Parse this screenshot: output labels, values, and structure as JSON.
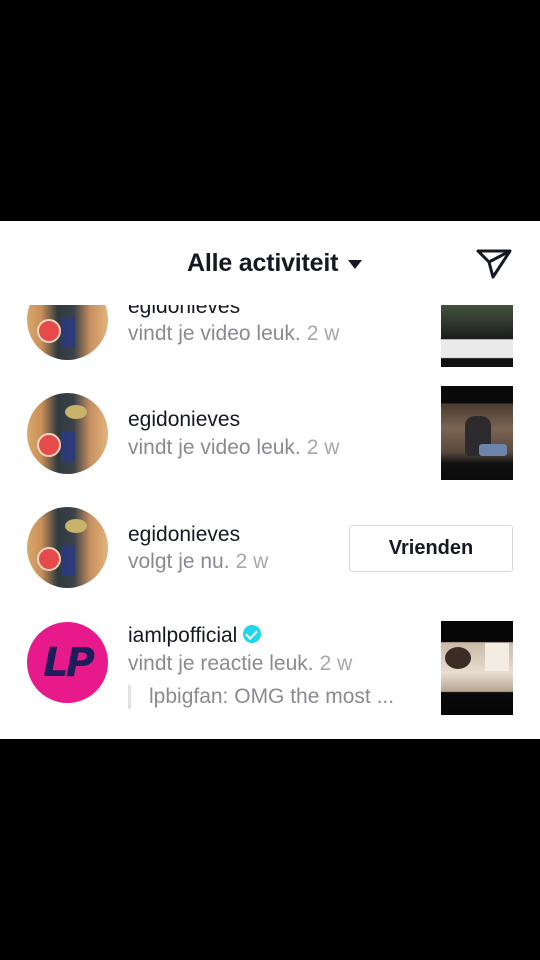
{
  "header": {
    "title": "Alle activiteit",
    "filter_icon": "caret-down-icon",
    "send_icon": "paper-plane-icon"
  },
  "notifications": [
    {
      "username": "egidonieves",
      "action": "vindt je video leuk.",
      "time": "2 w",
      "has_thumbnail": true
    },
    {
      "username": "egidonieves",
      "action": "vindt je video leuk.",
      "time": "2 w",
      "has_thumbnail": true
    },
    {
      "username": "egidonieves",
      "action": "volgt je nu.",
      "time": "2 w",
      "button_label": "Vrienden"
    },
    {
      "username": "iamlpofficial",
      "verified": true,
      "action": "vindt je reactie leuk.",
      "time": "2 w",
      "comment": "lpbigfan: OMG the most ...",
      "avatar_text": "LP",
      "has_thumbnail": true
    }
  ],
  "colors": {
    "background": "#000000",
    "panel": "#ffffff",
    "text_primary": "#161823",
    "text_secondary": "#8a8b91",
    "verified": "#20d5ec",
    "lp_avatar": "#e8198a"
  }
}
